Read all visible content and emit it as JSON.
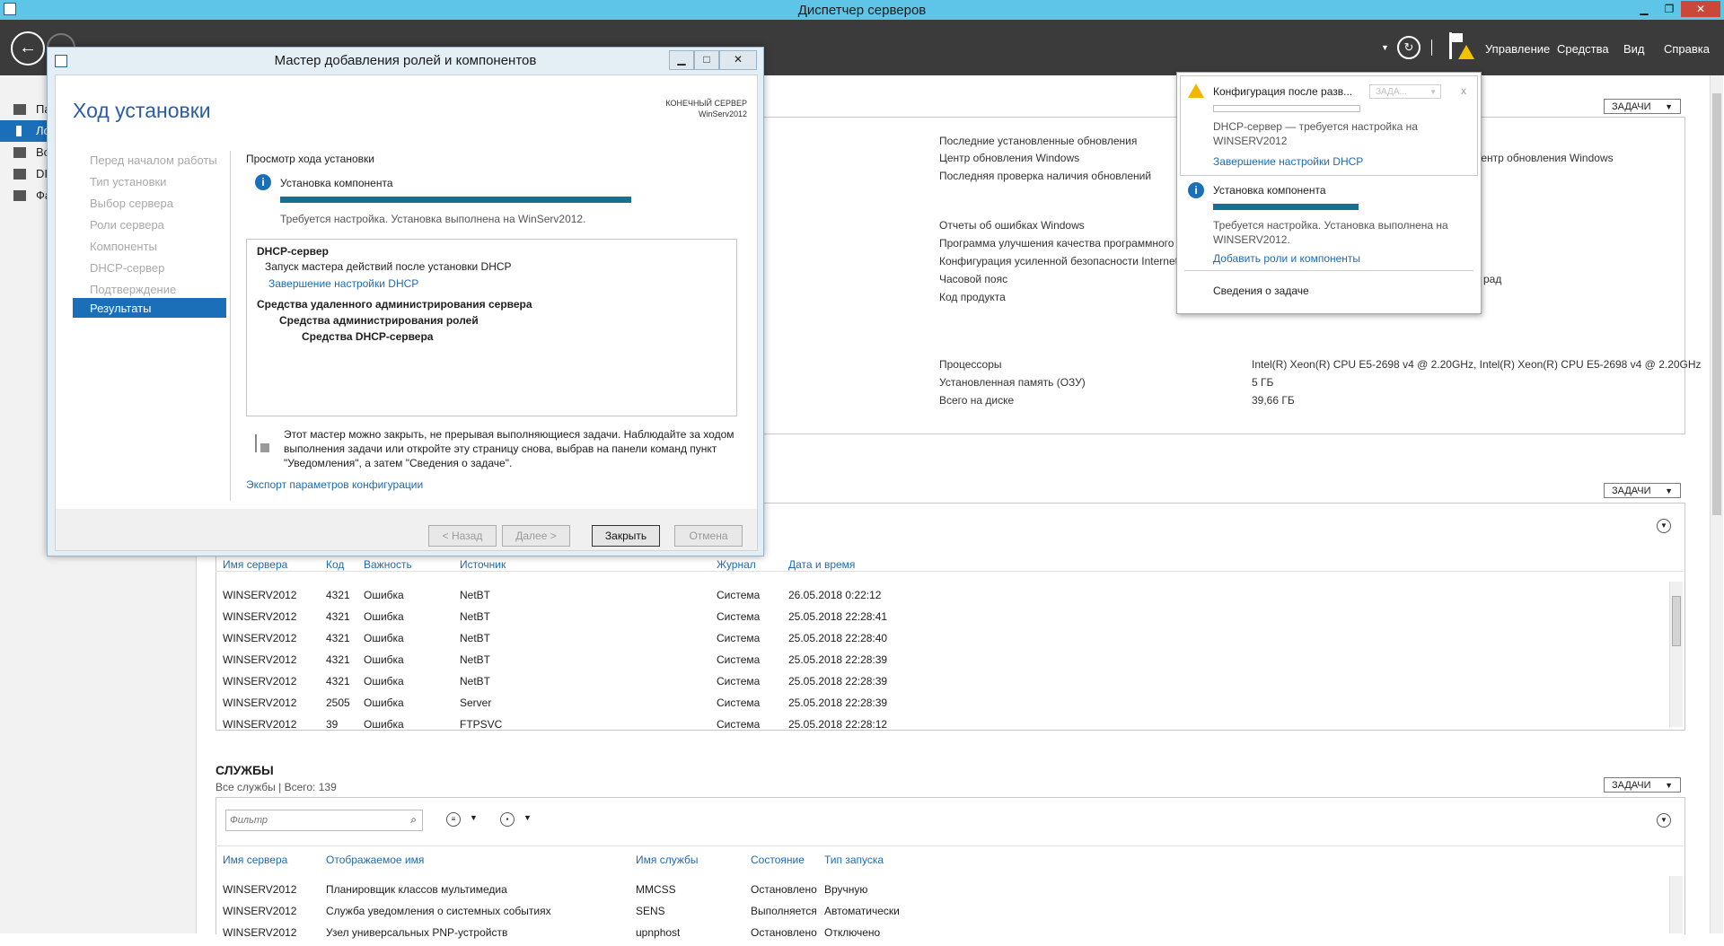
{
  "window": {
    "title": "Диспетчер серверов"
  },
  "header": {
    "menu": [
      "Управление",
      "Средства",
      "Вид",
      "Справка"
    ]
  },
  "nav": {
    "items": [
      {
        "label": "Па",
        "selected": false
      },
      {
        "label": "Ло",
        "selected": true
      },
      {
        "label": "Вс",
        "selected": false
      },
      {
        "label": "DI",
        "selected": false
      },
      {
        "label": "Фа",
        "selected": false
      }
    ]
  },
  "props_panel": {
    "tasks_label": "ЗАДАЧИ",
    "rows1": [
      {
        "key": "Последние установленные обновления",
        "value": ""
      },
      {
        "key": "Центр обновления Windows",
        "value": "щью Центр обновления Windows"
      },
      {
        "key": "Последняя проверка наличия обновлений",
        "value": ""
      }
    ],
    "rows2": [
      {
        "key": "Отчеты об ошибках Windows",
        "value": ""
      },
      {
        "key": "Программа улучшения качества программного",
        "value": ""
      },
      {
        "key": "Конфигурация усиленной безопасности Internet",
        "value": ""
      },
      {
        "key": "Часовой пояс",
        "value": "рад"
      },
      {
        "key": "Код продукта",
        "value": ""
      }
    ],
    "rows3": [
      {
        "key": "Процессоры",
        "value": "Intel(R) Xeon(R) CPU E5-2698 v4 @ 2.20GHz, Intel(R) Xeon(R) CPU E5-2698 v4 @ 2.20GHz"
      },
      {
        "key": "Установленная память (ОЗУ)",
        "value": "5 ГБ"
      },
      {
        "key": "Всего на диске",
        "value": "39,66 ГБ"
      }
    ]
  },
  "events": {
    "tasks_label": "ЗАДАЧИ",
    "columns": [
      "Имя сервера",
      "Код",
      "Важность",
      "Источник",
      "Журнал",
      "Дата и время"
    ],
    "rows": [
      [
        "WINSERV2012",
        "4321",
        "Ошибка",
        "NetBT",
        "Система",
        "26.05.2018 0:22:12"
      ],
      [
        "WINSERV2012",
        "4321",
        "Ошибка",
        "NetBT",
        "Система",
        "25.05.2018 22:28:41"
      ],
      [
        "WINSERV2012",
        "4321",
        "Ошибка",
        "NetBT",
        "Система",
        "25.05.2018 22:28:40"
      ],
      [
        "WINSERV2012",
        "4321",
        "Ошибка",
        "NetBT",
        "Система",
        "25.05.2018 22:28:39"
      ],
      [
        "WINSERV2012",
        "4321",
        "Ошибка",
        "NetBT",
        "Система",
        "25.05.2018 22:28:39"
      ],
      [
        "WINSERV2012",
        "2505",
        "Ошибка",
        "Server",
        "Система",
        "25.05.2018 22:28:39"
      ],
      [
        "WINSERV2012",
        "39",
        "Ошибка",
        "FTPSVC",
        "Система",
        "25.05.2018 22:28:12"
      ]
    ]
  },
  "services": {
    "title": "СЛУЖБЫ",
    "subtitle": "Все службы | Всего: 139",
    "tasks_label": "ЗАДАЧИ",
    "filter_placeholder": "Фильтр",
    "columns": [
      "Имя сервера",
      "Отображаемое имя",
      "Имя службы",
      "Состояние",
      "Тип запуска"
    ],
    "rows": [
      [
        "WINSERV2012",
        "Планировщик классов мультимедиа",
        "MMCSS",
        "Остановлено",
        "Вручную"
      ],
      [
        "WINSERV2012",
        "Служба уведомления о системных событиях",
        "SENS",
        "Выполняется",
        "Автоматически"
      ],
      [
        "WINSERV2012",
        "Узел универсальных PNP-устройств",
        "upnphost",
        "Остановлено",
        "Отключено"
      ]
    ]
  },
  "wizard": {
    "title": "Мастер добавления ролей и компонентов",
    "heading": "Ход установки",
    "dest_label": "КОНЕЧНЫЙ СЕРВЕР",
    "dest_server": "WinServ2012",
    "steps": [
      "Перед началом работы",
      "Тип установки",
      "Выбор сервера",
      "Роли сервера",
      "Компоненты",
      "DHCP-сервер",
      "Подтверждение",
      "Результаты"
    ],
    "section_label": "Просмотр хода установки",
    "install_title": "Установка компонента",
    "install_progress": 1.0,
    "install_status": "Требуется настройка. Установка выполнена на WinServ2012.",
    "results": {
      "r1": "DHCP-сервер",
      "r2": "Запуск мастера действий после установки DHCP",
      "r3": "Завершение настройки DHCP",
      "r4": "Средства удаленного администрирования сервера",
      "r5": "Средства администрирования ролей",
      "r6": "Средства DHCP-сервера"
    },
    "note": "Этот мастер можно закрыть, не прерывая выполняющиеся задачи. Наблюдайте за ходом выполнения задачи или откройте эту страницу снова, выбрав на панели команд пункт \"Уведомления\", а затем \"Сведения о задаче\".",
    "export_link": "Экспорт параметров конфигурации",
    "buttons": {
      "back": "< Назад",
      "next": "Далее >",
      "close": "Закрыть",
      "cancel": "Отмена"
    }
  },
  "notifications": {
    "n1_title": "Конфигурация после разв...",
    "n1_task": "ЗАДА...",
    "n1_text": "DHCP-сервер — требуется настройка на WINSERV2012",
    "n1_link": "Завершение настройки DHCP",
    "n2_title": "Установка компонента",
    "n2_progress": 1.0,
    "n2_text": "Требуется настройка. Установка выполнена на WINSERV2012.",
    "n2_link": "Добавить роли и компоненты",
    "task_details": "Сведения о задаче"
  }
}
